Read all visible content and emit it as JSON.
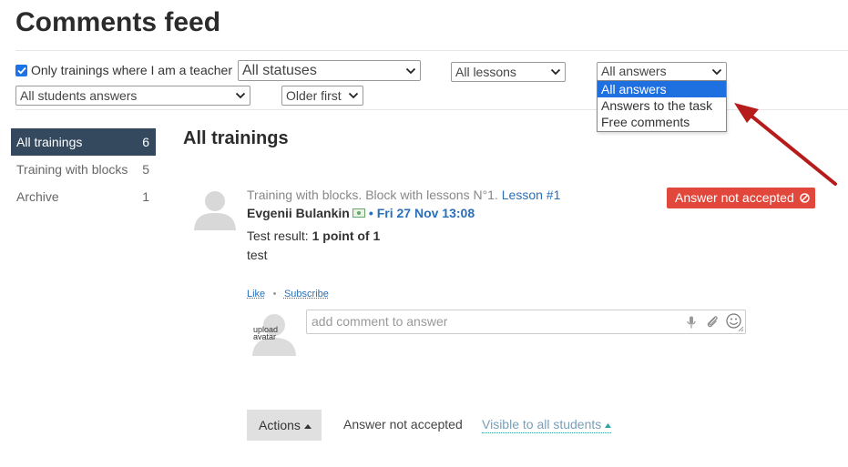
{
  "page": {
    "title": "Comments feed"
  },
  "filters": {
    "only_teacher_label": "Only trainings where I am a teacher",
    "only_teacher_checked": true,
    "status_select": "All statuses",
    "lessons_select": "All lessons",
    "answers_select": "All answers",
    "students_select": "All students answers",
    "order_select": "Older first"
  },
  "answers_dropdown": {
    "options": [
      "All answers",
      "Answers to the task",
      "Free comments"
    ],
    "selected": "All answers"
  },
  "sidebar": {
    "items": [
      {
        "label": "All trainings",
        "count": "6",
        "active": true
      },
      {
        "label": "Training with blocks",
        "count": "5",
        "active": false
      },
      {
        "label": "Archive",
        "count": "1",
        "active": false
      }
    ]
  },
  "main": {
    "heading": "All trainings"
  },
  "comment": {
    "context_text": "Training with blocks. Block with lessons N°1.",
    "lesson_link": "Lesson #1",
    "author": "Evgenii Bulankin",
    "separator": "•",
    "date": "Fri 27 Nov 13:08",
    "badge": "Answer not accepted",
    "result_label": "Test result:",
    "result_value": "1 point of 1",
    "text": "test",
    "like_label": "Like",
    "dot": "•",
    "subscribe_label": "Subscribe",
    "upload_avatar_line1": "upload",
    "upload_avatar_line2": "avatar",
    "input_placeholder": "add comment to answer"
  },
  "footer": {
    "actions_label": "Actions",
    "status_text": "Answer not accepted",
    "visibility_label": "Visible to all students"
  },
  "colors": {
    "accent_blue": "#2a6fb8",
    "sidebar_active": "#34495e",
    "badge_red": "#e2473b",
    "arrow_red": "#b71c1c",
    "dropdown_highlight": "#1e6fe0"
  }
}
